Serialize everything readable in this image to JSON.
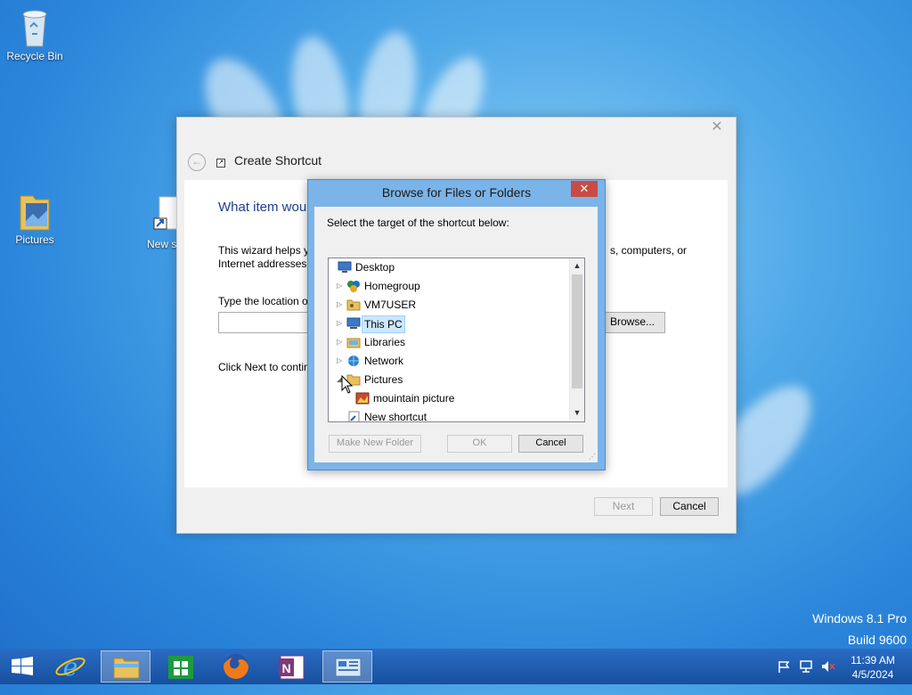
{
  "desktop": {
    "icons": [
      {
        "label": "Recycle Bin"
      },
      {
        "label": "Pictures"
      },
      {
        "label": "New sh"
      }
    ],
    "watermark": {
      "line1": "Windows 8.1 Pro",
      "line2": "Build 9600"
    }
  },
  "wizard": {
    "title": "Create Shortcut",
    "heading": "What item wou",
    "intro_left_line1": "This wizard helps yo",
    "intro_left_line2": "Internet addresses.",
    "intro_right": "s, computers, or",
    "location_label": "Type the location o",
    "location_value": "",
    "browse_label": "Browse...",
    "next_text": "Click Next to contin",
    "next_label": "Next",
    "cancel_label": "Cancel"
  },
  "browse_dialog": {
    "title": "Browse for Files or Folders",
    "close_label": "✕",
    "prompt": "Select the target of the shortcut below:",
    "tree": [
      {
        "label": "Desktop",
        "icon": "desktop-icon",
        "level": 0,
        "expander": "none"
      },
      {
        "label": "Homegroup",
        "icon": "homegroup-icon",
        "level": 1,
        "expander": "collapsed"
      },
      {
        "label": "VM7USER",
        "icon": "user-folder-icon",
        "level": 1,
        "expander": "collapsed"
      },
      {
        "label": "This PC",
        "icon": "computer-icon",
        "level": 1,
        "expander": "collapsed",
        "selected": true
      },
      {
        "label": "Libraries",
        "icon": "libraries-icon",
        "level": 1,
        "expander": "collapsed"
      },
      {
        "label": "Network",
        "icon": "network-icon",
        "level": 1,
        "expander": "collapsed"
      },
      {
        "label": "Pictures",
        "icon": "folder-icon",
        "level": 1,
        "expander": "expanded"
      },
      {
        "label": "mouintain picture",
        "icon": "image-file-icon",
        "level": 2,
        "expander": "none"
      },
      {
        "label": "New shortcut",
        "icon": "shortcut-icon",
        "level": 1,
        "expander": "none"
      }
    ],
    "make_folder_label": "Make New Folder",
    "ok_label": "OK",
    "cancel_label": "Cancel"
  },
  "taskbar": {
    "apps": [
      "start-icon",
      "internet-explorer-icon",
      "file-explorer-icon",
      "store-icon",
      "firefox-icon",
      "onenote-icon",
      "control-panel-icon"
    ],
    "clock_time": "11:39 AM",
    "clock_date": "4/5/2024"
  }
}
